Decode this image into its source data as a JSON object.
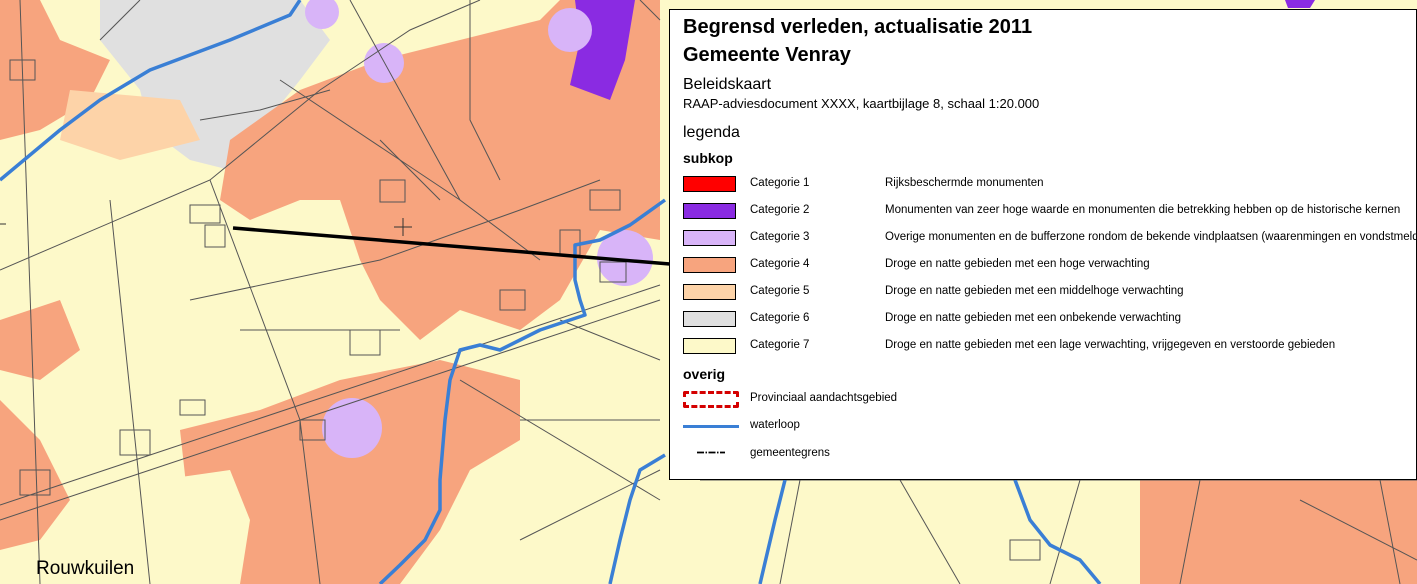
{
  "map": {
    "place_label": "Rouwkuilen"
  },
  "legend": {
    "title_line1": "Begrensd verleden, actualisatie 2011",
    "title_line2": "Gemeente Venray",
    "map_type": "Beleidskaart",
    "reference": "RAAP-adviesdocument XXXX, kaartbijlage 8, schaal 1:20.000",
    "legend_label": "legenda",
    "subkop_label": "subkop",
    "categories": [
      {
        "label": "Categorie 1",
        "description": "Rijksbeschermde monumenten",
        "color": "#ff0000"
      },
      {
        "label": "Categorie 2",
        "description": "Monumenten van zeer hoge waarde en monumenten die betrekking hebben op de historische kernen",
        "color": "#8a2be2"
      },
      {
        "label": "Categorie 3",
        "description": "Overige monumenten en de bufferzone rondom de bekende vindplaatsen (waarenmingen en vondstmeldingen)",
        "color": "#d8b4f8"
      },
      {
        "label": "Categorie 4",
        "description": "Droge en natte gebieden met een hoge verwachting",
        "color": "#f7a47e"
      },
      {
        "label": "Categorie 5",
        "description": "Droge en natte gebieden met een middelhoge verwachting",
        "color": "#fdd3a8"
      },
      {
        "label": "Categorie 6",
        "description": "Droge en natte gebieden met een onbekende verwachting",
        "color": "#e0e0e0"
      },
      {
        "label": "Categorie 7",
        "description": "Droge en natte gebieden met een lage verwachting, vrijgegeven en verstoorde gebieden",
        "color": "#fdf9c9"
      }
    ],
    "overig_label": "overig",
    "overig": [
      {
        "label": "Provinciaal aandachtsgebied",
        "icon": "red-dashed-outline-icon",
        "color": "#d40000"
      },
      {
        "label": "waterloop",
        "icon": "blue-line-icon",
        "color": "#3a7fd5"
      },
      {
        "label": "gemeentegrens",
        "icon": "dash-dot-line-icon",
        "color": "#000000"
      }
    ]
  }
}
